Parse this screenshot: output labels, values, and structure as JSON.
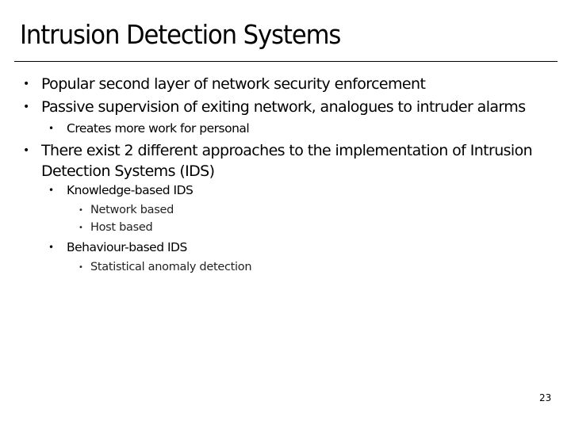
{
  "slide": {
    "title": "Intrusion Detection Systems",
    "page_number": "23",
    "bullets": [
      {
        "level": 1,
        "text": "Popular second layer of network security enforcement"
      },
      {
        "level": 1,
        "text": "Passive supervision of exiting network, analogues to intruder alarms"
      },
      {
        "level": 2,
        "text": "Creates more work for personal"
      },
      {
        "level": 1,
        "text": "There exist 2 different approaches to the implementation of Intrusion Detection Systems (IDS)"
      },
      {
        "level": 2,
        "text": "Knowledge-based IDS"
      },
      {
        "level": 3,
        "text": "Network based"
      },
      {
        "level": 3,
        "text": "Host based"
      },
      {
        "level": 2,
        "text": "Behaviour-based IDS"
      },
      {
        "level": 3,
        "text": "Statistical anomaly detection"
      }
    ],
    "bullet_glyph": "•"
  }
}
